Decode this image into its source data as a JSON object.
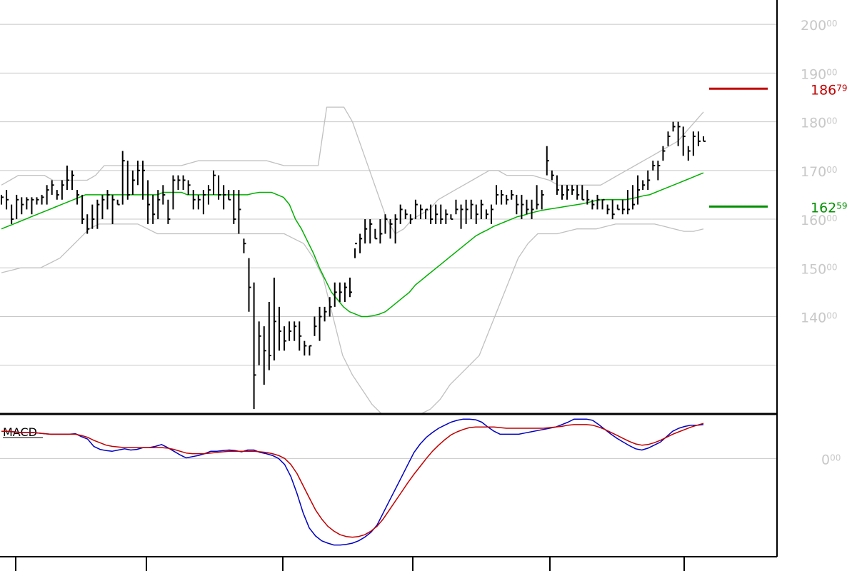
{
  "chart_data": [
    {
      "type": "ohlc",
      "ylim": [
        120,
        205
      ],
      "y_ticks": [
        {
          "value": 130,
          "label": ""
        },
        {
          "value": 140,
          "label": "140",
          "sup": "00"
        },
        {
          "value": 150,
          "label": "150",
          "sup": "00"
        },
        {
          "value": 160,
          "label": "160",
          "sup": "00"
        },
        {
          "value": 170,
          "label": "170",
          "sup": "00"
        },
        {
          "value": 180,
          "label": "180",
          "sup": "00"
        },
        {
          "value": 190,
          "label": "190",
          "sup": "00"
        },
        {
          "value": 200,
          "label": "200",
          "sup": "00"
        }
      ],
      "markers": [
        {
          "name": "upper",
          "value": 186.79,
          "label": "186",
          "sup": "79",
          "color": "#c00000"
        },
        {
          "name": "lower",
          "value": 162.59,
          "label": "162",
          "sup": "59",
          "color": "#009000"
        }
      ],
      "bars": [
        [
          165,
          163,
          164.5
        ],
        [
          166,
          162,
          164
        ],
        [
          163,
          159,
          160
        ],
        [
          165,
          160,
          164
        ],
        [
          164.5,
          161,
          163
        ],
        [
          164.5,
          162,
          164
        ],
        [
          164.5,
          161,
          164
        ],
        [
          164.5,
          163,
          164
        ],
        [
          165,
          163,
          164.5
        ],
        [
          167,
          163,
          166
        ],
        [
          168,
          165,
          167
        ],
        [
          166,
          164,
          165
        ],
        [
          168,
          164,
          167
        ],
        [
          171,
          166,
          168
        ],
        [
          170,
          166,
          169
        ],
        [
          166,
          163,
          165
        ],
        [
          165,
          159,
          160
        ],
        [
          161,
          157,
          158
        ],
        [
          163,
          158,
          160
        ],
        [
          164,
          158,
          163
        ],
        [
          165,
          160,
          164
        ],
        [
          166,
          162,
          165
        ],
        [
          165,
          159,
          164
        ],
        [
          164,
          163,
          163
        ],
        [
          174,
          163,
          172
        ],
        [
          172,
          164,
          165
        ],
        [
          170,
          165,
          168
        ],
        [
          172,
          167,
          170
        ],
        [
          172,
          164,
          170
        ],
        [
          168,
          159,
          163
        ],
        [
          165,
          159,
          161
        ],
        [
          166,
          160,
          164
        ],
        [
          167,
          163,
          165
        ],
        [
          164,
          159,
          160
        ],
        [
          169,
          162,
          168
        ],
        [
          169,
          166,
          168
        ],
        [
          169,
          166,
          168
        ],
        [
          168,
          165,
          167
        ],
        [
          166,
          162,
          164
        ],
        [
          165,
          162,
          164
        ],
        [
          166,
          161,
          165
        ],
        [
          167,
          163,
          166
        ],
        [
          170,
          165,
          169
        ],
        [
          169,
          164,
          165
        ],
        [
          167,
          162,
          165
        ],
        [
          166,
          164,
          164
        ],
        [
          166,
          159,
          160
        ],
        [
          166,
          157,
          162
        ],
        [
          156,
          153,
          155
        ],
        [
          152,
          141,
          146
        ],
        [
          147,
          121,
          128
        ],
        [
          139,
          130,
          136
        ],
        [
          138,
          126,
          133
        ],
        [
          143,
          129,
          132
        ],
        [
          148,
          131,
          139
        ],
        [
          142,
          133,
          137
        ],
        [
          138,
          133,
          135
        ],
        [
          139,
          135,
          137
        ],
        [
          139,
          135,
          138
        ],
        [
          139,
          133,
          136
        ],
        [
          135,
          132,
          134
        ],
        [
          134,
          132,
          134
        ],
        [
          140,
          136,
          138
        ],
        [
          142,
          135,
          140
        ],
        [
          142,
          139,
          141
        ],
        [
          144,
          140,
          142
        ],
        [
          147,
          142,
          145
        ],
        [
          147,
          143,
          145
        ],
        [
          147,
          143,
          146
        ],
        [
          148,
          144,
          145
        ],
        [
          154,
          152,
          155
        ],
        [
          157,
          153,
          156
        ],
        [
          160,
          155,
          158
        ],
        [
          160,
          155,
          159
        ],
        [
          158,
          156,
          156
        ],
        [
          160,
          155,
          157
        ],
        [
          161,
          157,
          160
        ],
        [
          160,
          156,
          159
        ],
        [
          161,
          155,
          160
        ],
        [
          163,
          159,
          162
        ],
        [
          162,
          160,
          161
        ],
        [
          161,
          159,
          160
        ],
        [
          164,
          160,
          163
        ],
        [
          163,
          160,
          162
        ],
        [
          162,
          160,
          162
        ],
        [
          163,
          159,
          160
        ],
        [
          163,
          159,
          161
        ],
        [
          163,
          159,
          160
        ],
        [
          162,
          159,
          161
        ],
        [
          161,
          160,
          160
        ],
        [
          164,
          161,
          162
        ],
        [
          163,
          158,
          162
        ],
        [
          164,
          159,
          162
        ],
        [
          164,
          160,
          163
        ],
        [
          163,
          159,
          161
        ],
        [
          164,
          160,
          163
        ],
        [
          162,
          160,
          161
        ],
        [
          163,
          159,
          162
        ],
        [
          167,
          163,
          165
        ],
        [
          166,
          163,
          165
        ],
        [
          165,
          163,
          164
        ],
        [
          166,
          164,
          165
        ],
        [
          165,
          161,
          163
        ],
        [
          165,
          160,
          163
        ],
        [
          164,
          161,
          162
        ],
        [
          164,
          160,
          162
        ],
        [
          167,
          162,
          163
        ],
        [
          166,
          162,
          165
        ],
        [
          175,
          169,
          172
        ],
        [
          170,
          168,
          169
        ],
        [
          169,
          165,
          166
        ],
        [
          167,
          164,
          165
        ],
        [
          167,
          164,
          166
        ],
        [
          167,
          165,
          166
        ],
        [
          167,
          164,
          165
        ],
        [
          167,
          164,
          164
        ],
        [
          166,
          163,
          164
        ],
        [
          164,
          162,
          163
        ],
        [
          165,
          162,
          164
        ],
        [
          164,
          162,
          164
        ],
        [
          163,
          161,
          162
        ],
        [
          164,
          160,
          161
        ],
        [
          163,
          162,
          162
        ],
        [
          164,
          161,
          162
        ],
        [
          166,
          161,
          162
        ],
        [
          167,
          162,
          163
        ],
        [
          169,
          163,
          166
        ],
        [
          168,
          166,
          167
        ],
        [
          170,
          166,
          168
        ],
        [
          172,
          170,
          171
        ],
        [
          172,
          168,
          171
        ],
        [
          175,
          172,
          174
        ],
        [
          178,
          175,
          177
        ],
        [
          180,
          178,
          179
        ],
        [
          180,
          175,
          179
        ],
        [
          179,
          173,
          177
        ],
        [
          175,
          172,
          174
        ],
        [
          178,
          173,
          177
        ],
        [
          178,
          175,
          176
        ],
        [
          177,
          176,
          176
        ]
      ],
      "ma": [
        158,
        158.5,
        159,
        159.5,
        160,
        160.5,
        161,
        161.5,
        162,
        162.5,
        163,
        163.5,
        164,
        164.5,
        165,
        165,
        165,
        165,
        165,
        165,
        165,
        165,
        165,
        165,
        165,
        165,
        165,
        165.5,
        165.5,
        165.5,
        165.5,
        165,
        165,
        165,
        165,
        165,
        165,
        165,
        165,
        165,
        165,
        165,
        165.3,
        165.5,
        165.5,
        165.5,
        165,
        164.5,
        163,
        160,
        158,
        155.5,
        153,
        150,
        147.5,
        145,
        143.5,
        142,
        141,
        140.5,
        140,
        140,
        140.2,
        140.5,
        141,
        142,
        143,
        144,
        145,
        146.5,
        147.5,
        148.5,
        149.5,
        150.5,
        151.5,
        152.5,
        153.5,
        154.5,
        155.5,
        156.5,
        157.2,
        157.8,
        158.5,
        159,
        159.5,
        160,
        160.5,
        160.8,
        161.2,
        161.5,
        161.8,
        162,
        162.2,
        162.4,
        162.6,
        162.8,
        163,
        163.2,
        163.5,
        163.8,
        164,
        164,
        164,
        164,
        164,
        164.2,
        164.5,
        164.8,
        165,
        165.5,
        166,
        166.5,
        167,
        167.5,
        168,
        168.5,
        169,
        169.5
      ],
      "bb_upper": [
        167,
        168,
        169,
        169,
        169,
        169,
        168,
        168,
        168,
        168,
        168,
        169,
        171,
        171,
        171,
        171,
        171,
        171,
        171,
        171,
        171,
        171,
        171.5,
        172,
        172,
        172,
        172,
        172,
        172,
        172,
        172,
        172,
        171.5,
        171,
        171,
        171,
        171,
        171,
        183,
        183,
        183,
        180,
        175,
        170,
        165,
        160,
        157,
        158,
        160,
        161,
        162,
        164,
        165,
        166,
        167,
        168,
        169,
        170,
        170,
        169,
        169,
        169,
        169,
        168.5,
        168,
        167,
        167,
        167,
        167,
        167,
        167,
        168,
        169,
        170,
        171,
        172,
        173,
        174,
        175,
        176,
        178,
        180,
        182
      ],
      "bb_lower": [
        149,
        149.5,
        150,
        150,
        150,
        151,
        152,
        154,
        156,
        158,
        159,
        159,
        159,
        159,
        159,
        158,
        157,
        157,
        157,
        157,
        157,
        157,
        157,
        157,
        157,
        157,
        157,
        157,
        157,
        157,
        156,
        155,
        152,
        148,
        140,
        132,
        128,
        125,
        122,
        120,
        120,
        120,
        120,
        120,
        121,
        123,
        126,
        128,
        130,
        132,
        137,
        142,
        147,
        152,
        155,
        157,
        157,
        157,
        157.5,
        158,
        158,
        158,
        158.5,
        159,
        159,
        159,
        159,
        159,
        158.5,
        158,
        157.5,
        157.5,
        158
      ]
    },
    {
      "type": "line",
      "title": "MACD",
      "ylim": [
        -16,
        7
      ],
      "y_ticks": [
        {
          "value": 0,
          "label": "0",
          "sup": "00"
        }
      ],
      "series": [
        {
          "key": "macd",
          "color": "#0000c0",
          "values": [
            4.5,
            4.5,
            4.4,
            4.3,
            4.3,
            4.3,
            4.2,
            4.1,
            4.0,
            4.0,
            4.0,
            4.0,
            4.1,
            3.6,
            3.2,
            2.0,
            1.5,
            1.3,
            1.2,
            1.4,
            1.6,
            1.4,
            1.5,
            1.8,
            1.8,
            2.0,
            2.3,
            1.8,
            1.2,
            0.6,
            0.1,
            0.3,
            0.5,
            0.8,
            1.2,
            1.2,
            1.3,
            1.4,
            1.3,
            1.1,
            1.4,
            1.4,
            1.0,
            0.8,
            0.5,
            0.0,
            -1.0,
            -3.0,
            -5.8,
            -9.0,
            -11.5,
            -12.8,
            -13.6,
            -14.0,
            -14.3,
            -14.3,
            -14.2,
            -14.0,
            -13.6,
            -13.0,
            -12.2,
            -11.0,
            -9.0,
            -7.0,
            -5.0,
            -3.0,
            -1.0,
            1.0,
            2.4,
            3.5,
            4.3,
            5.0,
            5.5,
            6.0,
            6.3,
            6.5,
            6.5,
            6.4,
            6.0,
            5.2,
            4.5,
            4.0,
            4.0,
            4.0,
            4.0,
            4.2,
            4.4,
            4.6,
            4.8,
            5.0,
            5.2,
            5.6,
            6.0,
            6.5,
            6.5,
            6.5,
            6.3,
            5.6,
            4.8,
            4.0,
            3.3,
            2.7,
            2.1,
            1.6,
            1.4,
            1.7,
            2.2,
            2.7,
            3.6,
            4.5,
            5.0,
            5.3,
            5.5,
            5.5,
            5.6
          ]
        },
        {
          "key": "signal",
          "color": "#c00000",
          "values": [
            4.5,
            4.5,
            4.4,
            4.3,
            4.3,
            4.3,
            4.2,
            4.1,
            4.0,
            4.0,
            4.0,
            4.0,
            4.0,
            3.8,
            3.5,
            3.0,
            2.6,
            2.2,
            2.0,
            1.9,
            1.8,
            1.8,
            1.8,
            1.8,
            1.8,
            1.8,
            1.8,
            1.7,
            1.5,
            1.2,
            0.9,
            0.8,
            0.8,
            0.8,
            0.9,
            1.0,
            1.1,
            1.2,
            1.2,
            1.2,
            1.2,
            1.2,
            1.1,
            1.0,
            0.8,
            0.5,
            0.0,
            -1.0,
            -2.5,
            -4.5,
            -6.5,
            -8.5,
            -10.0,
            -11.2,
            -12.0,
            -12.6,
            -12.9,
            -13.0,
            -12.9,
            -12.6,
            -12.0,
            -11.2,
            -10.0,
            -8.5,
            -7.0,
            -5.5,
            -4.0,
            -2.6,
            -1.3,
            0.0,
            1.2,
            2.2,
            3.1,
            3.9,
            4.4,
            4.8,
            5.1,
            5.2,
            5.2,
            5.2,
            5.2,
            5.1,
            5.0,
            5.0,
            5.0,
            5.0,
            5.0,
            5.0,
            5.0,
            5.1,
            5.2,
            5.3,
            5.5,
            5.6,
            5.6,
            5.6,
            5.5,
            5.2,
            4.8,
            4.3,
            3.8,
            3.3,
            2.8,
            2.4,
            2.2,
            2.3,
            2.6,
            3.0,
            3.5,
            4.0,
            4.4,
            4.8,
            5.2,
            5.5,
            5.8
          ]
        }
      ]
    }
  ],
  "colors": {
    "background": "#ffffff",
    "grid": "#c8c8c8",
    "bars": "#000000",
    "moving_average": "#00b000",
    "bollinger": "#c0c0c0",
    "frame": "#000000"
  }
}
